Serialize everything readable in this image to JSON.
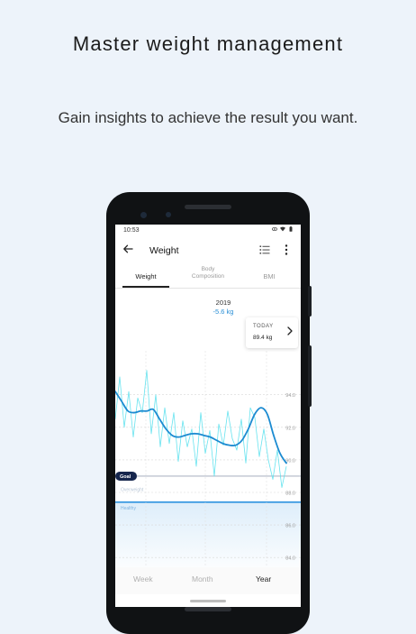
{
  "headline": "Master weight management",
  "subline": "Gain insights to achieve the result you want.",
  "status": {
    "time": "10:53"
  },
  "app": {
    "title": "Weight",
    "tabs": [
      {
        "label": "Weight"
      },
      {
        "label": "Body Composition"
      },
      {
        "label": "BMI"
      }
    ]
  },
  "summary": {
    "year": "2019",
    "delta": "-5.6 kg"
  },
  "today": {
    "label": "TODAY",
    "value": "89.4 kg"
  },
  "chart_data": {
    "type": "line",
    "y_ticks": [
      "94.0",
      "92.0",
      "90.0",
      "88.0",
      "86.0",
      "84.0"
    ],
    "y_tick_values": [
      94,
      92,
      90,
      88,
      86,
      84
    ],
    "ylim": [
      83.4,
      96.7
    ],
    "goal": {
      "label": "Goal",
      "value": 89.0
    },
    "zones": [
      {
        "label": "Overweight",
        "top_value": 89.0,
        "bottom_value": 87.4
      },
      {
        "label": "Healthy",
        "top_value": 87.4,
        "bottom_value": 83.4
      }
    ],
    "series": [
      {
        "values": [
          94.2,
          93.6,
          93.0,
          92.9,
          93.0,
          93.0,
          93.1,
          92.5,
          91.9,
          91.5,
          91.4,
          91.5,
          91.6,
          91.6,
          91.5,
          91.4,
          91.2,
          91.0,
          90.9,
          90.9,
          91.2,
          91.9,
          92.8,
          93.2,
          92.8,
          91.5,
          90.4,
          89.8
        ]
      },
      {
        "values": [
          92.5,
          95.1,
          92.0,
          94.2,
          91.4,
          93.8,
          92.9,
          95.5,
          91.6,
          94.0,
          90.8,
          93.2,
          91.0,
          92.9,
          89.9,
          92.4,
          90.8,
          91.9,
          89.6,
          92.9,
          90.4,
          91.8,
          89.0,
          92.2,
          90.9,
          93.0,
          91.3,
          90.6,
          92.5,
          89.8,
          93.2,
          92.6,
          90.2,
          91.9,
          90.0,
          88.8,
          90.6,
          88.3,
          89.6
        ]
      }
    ],
    "colors": {
      "trend": "#1c8bd1",
      "raw": "#5fe2ee",
      "goal": "#16264d",
      "healthy": "#2d93e0"
    }
  },
  "periods": [
    {
      "label": "Week",
      "active": false
    },
    {
      "label": "Month",
      "active": false
    },
    {
      "label": "Year",
      "active": true
    }
  ]
}
